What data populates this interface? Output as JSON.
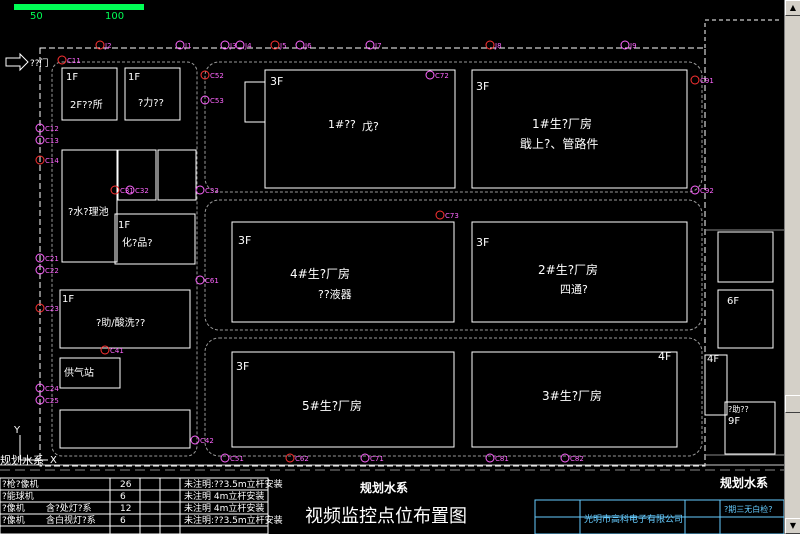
{
  "scale_hud": {
    "left_value": "50",
    "right_value": "100"
  },
  "buildings": {
    "b1": {
      "floor": "3F",
      "name": "1#??",
      "sub": "戊?"
    },
    "b2": {
      "floor": "3F",
      "name": "1#生?厂房",
      "sub": "戢上?、管路件"
    },
    "b3": {
      "floor": "3F",
      "name": "4#生?厂房",
      "sub": "??液器"
    },
    "b4": {
      "floor": "3F",
      "name": "2#生?厂房",
      "sub": "四通?"
    },
    "b5": {
      "floor": "3F",
      "name": "5#生?厂房",
      "sub": ""
    },
    "b6": {
      "floor": "4F",
      "name": "3#生?厂房",
      "sub": ""
    },
    "office": {
      "floor": "1F",
      "name": "?力??"
    },
    "dorm": {
      "floor": "1F",
      "name": "2F??所"
    },
    "lab": {
      "floor": "1F",
      "name": "?助/酸洗??"
    },
    "chem": {
      "floor": "1F",
      "name": "化?品?"
    },
    "pool": {
      "floor": "",
      "name": "?水?理池"
    },
    "gas": {
      "floor": "",
      "name": "供气站"
    },
    "east1": {
      "floor": "6F",
      "name": ""
    },
    "east2": {
      "floor": "4F",
      "name": ""
    },
    "east3": {
      "floor": "9F",
      "name": "?助??"
    }
  },
  "labels": {
    "drawing_title": "视频监控点位布置图",
    "road_south": "规划水系",
    "road_east": "规划水系",
    "road_west": "规划水系",
    "main_gate": "??门",
    "axis_y": "Y",
    "axis_x": "X",
    "company": "光明市高科电子有限公司",
    "tb_right": "?期三无白检?"
  },
  "cameras": [
    "C11",
    "C12",
    "C13",
    "C14",
    "C21",
    "C22",
    "C23",
    "C24",
    "C25",
    "C31",
    "C32",
    "C33",
    "C41",
    "C42",
    "C51",
    "C52",
    "C53",
    "C61",
    "C62",
    "C71",
    "C72",
    "C73",
    "C81",
    "C82",
    "C91",
    "C92",
    "J1",
    "J2",
    "J3",
    "J4",
    "J5",
    "J6",
    "J7",
    "J8",
    "J9"
  ],
  "legend": {
    "rows": [
      {
        "name": "?枪?像机",
        "qty": "26",
        "note": "未注明:??3.5m立杆安装"
      },
      {
        "name": "?能球机",
        "qty": "6",
        "note": "未注明 4m立杆安装"
      },
      {
        "name": "?像机",
        "qty": "12",
        "note": "未注明 4m立杆安装"
      },
      {
        "name": "?像机",
        "qty": "6",
        "note": "未注明:??3.5m立杆安装"
      }
    ],
    "mid_rows": [
      "含?处灯?系",
      "含白视灯?系"
    ]
  }
}
